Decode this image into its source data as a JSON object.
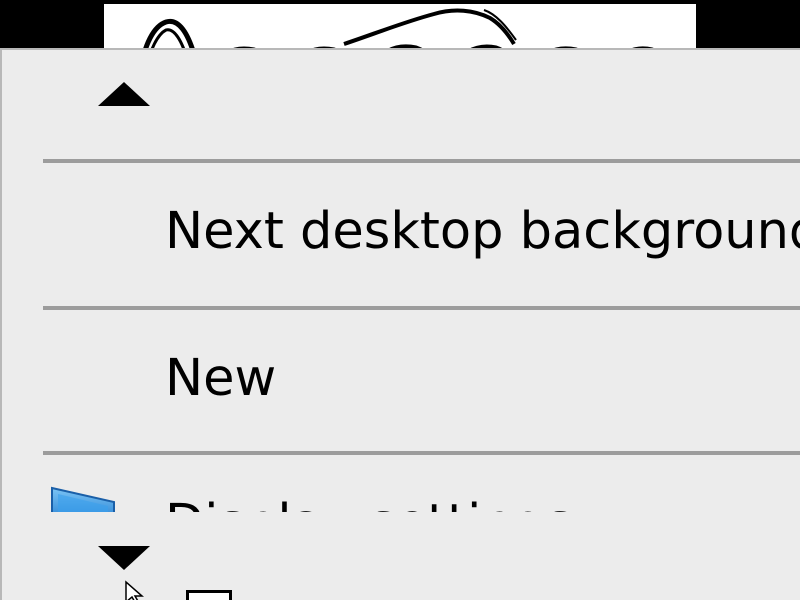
{
  "menu": {
    "scroll_up_icon": "triangle-up-icon",
    "scroll_down_icon": "triangle-down-icon",
    "items": [
      {
        "label": "Next desktop background"
      },
      {
        "label": "New"
      },
      {
        "label": "Display settings",
        "icon": "display-icon"
      }
    ]
  },
  "colors": {
    "menu_background": "#ececec",
    "separator": "#9c9c9c",
    "desktop": "#000000",
    "display_icon": "#2a8fe0"
  }
}
